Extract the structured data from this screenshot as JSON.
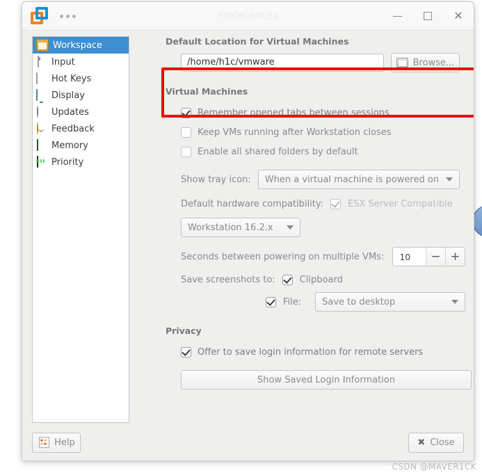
{
  "window": {
    "title": "Preferences",
    "logo_icon": "vmware-logo-icon",
    "menu_icon": "more-options-icon",
    "minimize_icon": "minimize-icon",
    "maximize_icon": "maximize-icon",
    "close_icon": "close-icon"
  },
  "sidebar": {
    "items": [
      {
        "label": "Workspace",
        "icon": "folder-icon",
        "selected": true
      },
      {
        "label": "Input",
        "icon": "mouse-icon",
        "selected": false
      },
      {
        "label": "Hot Keys",
        "icon": "keyboard-icon",
        "selected": false
      },
      {
        "label": "Display",
        "icon": "monitor-icon",
        "selected": false
      },
      {
        "label": "Updates",
        "icon": "updates-icon",
        "selected": false
      },
      {
        "label": "Feedback",
        "icon": "smiley-icon",
        "selected": false
      },
      {
        "label": "Memory",
        "icon": "memory-icon",
        "selected": false
      },
      {
        "label": "Priority",
        "icon": "priority-icon",
        "selected": false
      }
    ]
  },
  "default_location": {
    "group_title": "Default Location for Virtual Machines",
    "path_value": "/home/h1c/vmware",
    "browse_label": "Browse...",
    "browse_icon": "folder-open-icon",
    "highlight_color": "#f50000"
  },
  "virtual_machines": {
    "group_title": "Virtual Machines",
    "checkboxes": [
      {
        "label": "Remember opened tabs between sessions",
        "checked": true,
        "enabled": true
      },
      {
        "label": "Keep VMs running after Workstation closes",
        "checked": false,
        "enabled": false
      },
      {
        "label": "Enable all shared folders by default",
        "checked": false,
        "enabled": false
      }
    ],
    "tray_icon_label": "Show tray icon:",
    "tray_icon_value": "When a virtual machine is powered on",
    "hardware_compat_label": "Default hardware compatibility:",
    "esx_label": "ESX Server Compatible",
    "esx_checked": true,
    "hardware_version_value": "Workstation 16.2.x",
    "seconds_label": "Seconds between powering on multiple VMs:",
    "seconds_value": "10",
    "decrement_icon": "minus-icon",
    "increment_icon": "plus-icon",
    "screenshots_label": "Save screenshots to:",
    "clipboard_label": "Clipboard",
    "clipboard_checked": true,
    "file_label": "File:",
    "file_checked": true,
    "file_target_value": "Save to desktop"
  },
  "privacy": {
    "group_title": "Privacy",
    "offer_login_label": "Offer to save login information for remote servers",
    "offer_login_checked": true,
    "show_saved_label": "Show Saved Login Information"
  },
  "footer": {
    "help_label": "Help",
    "help_icon": "help-book-icon",
    "close_label": "Close",
    "close_icon": "close-x-icon"
  },
  "watermark": "CSDN @MAVER1CK"
}
